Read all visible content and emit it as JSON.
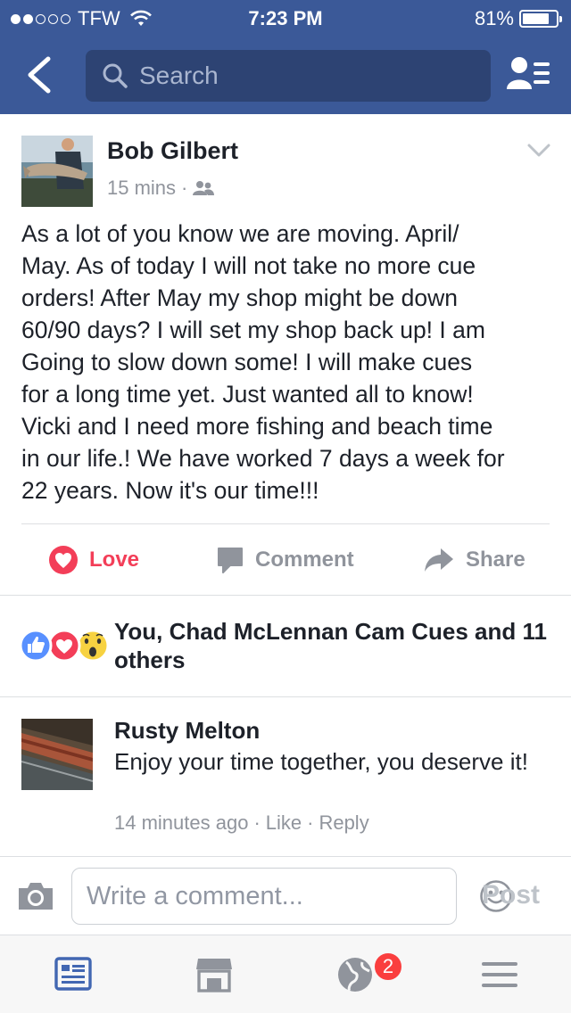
{
  "status": {
    "carrier": "TFW",
    "time": "7:23 PM",
    "battery": "81%",
    "battery_level": 0.81
  },
  "nav": {
    "search_placeholder": "Search"
  },
  "post": {
    "author": "Bob Gilbert",
    "time": "15 mins",
    "text": "As a lot of you know we are moving. April/\nMay. As of today I will not take no more cue\norders! After May my shop might be down\n60/90 days? I will set my shop back up! I am\nGoing to slow down some! I will make cues\nfor a long time yet. Just wanted all to know!\nVicki and I need more fishing and beach time\nin our life.! We have worked 7 days a week for\n22 years. Now it's our time!!!"
  },
  "actions": {
    "love": "Love",
    "comment": "Comment",
    "share": "Share"
  },
  "reactions": {
    "text": "You, Chad McLennan Cam Cues and 11 others"
  },
  "comment": {
    "author": "Rusty Melton",
    "text": "Enjoy your time together, you deserve it!",
    "time": "14 minutes ago",
    "like": "Like",
    "reply": "Reply"
  },
  "composer": {
    "placeholder": "Write a comment...",
    "post": "Post"
  },
  "tabbar": {
    "notifications_badge": "2"
  },
  "colors": {
    "brand": "#3b5998",
    "love": "#f33e58",
    "like": "#5890ff",
    "badge": "#fa3e3e"
  }
}
